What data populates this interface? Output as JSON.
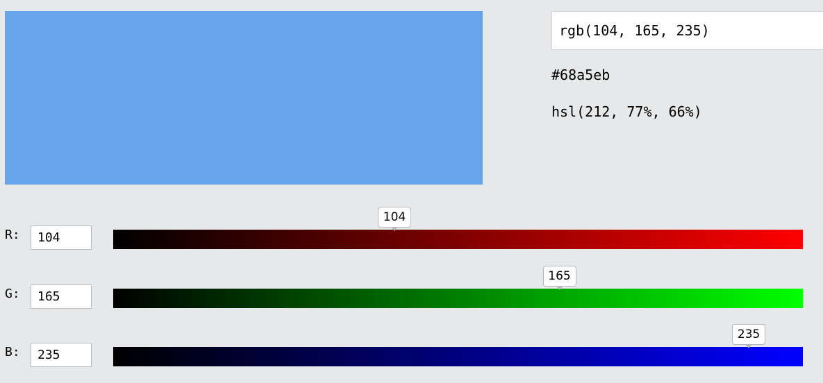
{
  "color": {
    "r": 104,
    "g": 165,
    "b": 235,
    "max": 255,
    "swatch_hex": "#68a5eb",
    "rgb_text": "rgb(104, 165, 235)",
    "hex_text": "#68a5eb",
    "hsl_text": "hsl(212, 77%, 66%)"
  },
  "channels": {
    "r": {
      "label": "R:",
      "value": "104",
      "tooltip": "104",
      "gradient_end": "#ff0000"
    },
    "g": {
      "label": "G:",
      "value": "165",
      "tooltip": "165",
      "gradient_end": "#00ff00"
    },
    "b": {
      "label": "B:",
      "value": "235",
      "tooltip": "235",
      "gradient_end": "#0000ff"
    }
  }
}
